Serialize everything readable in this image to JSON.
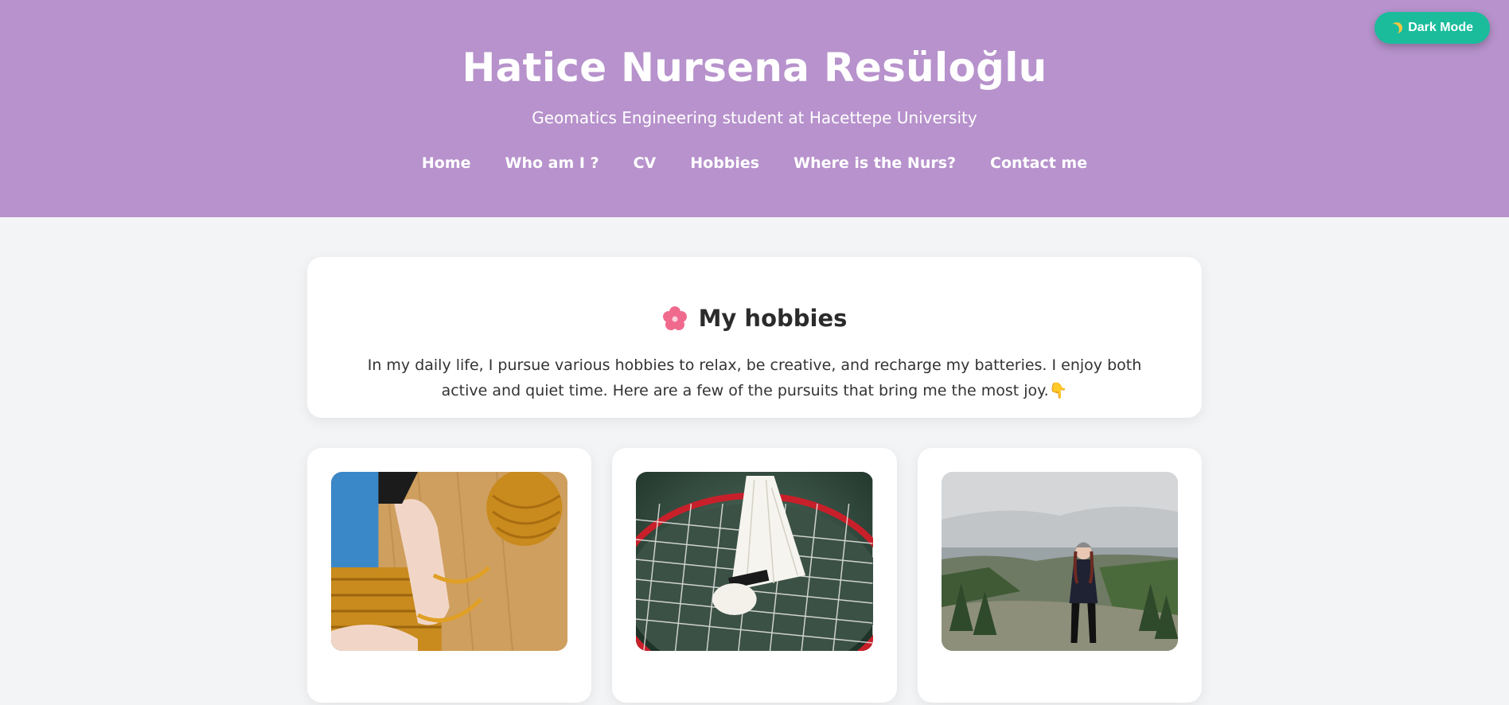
{
  "header": {
    "title": "Hatice Nursena Resüloğlu",
    "subtitle": "Geomatics Engineering student at Hacettepe University",
    "background": "#b792cc"
  },
  "nav": {
    "items": [
      {
        "label": "Home"
      },
      {
        "label": "Who am I ?"
      },
      {
        "label": "CV"
      },
      {
        "label": "Hobbies"
      },
      {
        "label": "Where is the Nurs?"
      },
      {
        "label": "Contact me"
      }
    ]
  },
  "dark_mode": {
    "label": "Dark Mode",
    "icon": "moon-icon",
    "color": "#1abc9c"
  },
  "intro": {
    "icon": "flower-icon",
    "heading": "My hobbies",
    "text": "In my daily life, I pursue various hobbies to relax, be creative, and recharge my batteries. I enjoy both active and quiet time. Here are a few of the pursuits that bring me the most joy.",
    "end_icon": "pointing-down-icon"
  },
  "hobby_cards": [
    {
      "image": "knitting-photo"
    },
    {
      "image": "badminton-photo"
    },
    {
      "image": "hiking-photo"
    }
  ]
}
